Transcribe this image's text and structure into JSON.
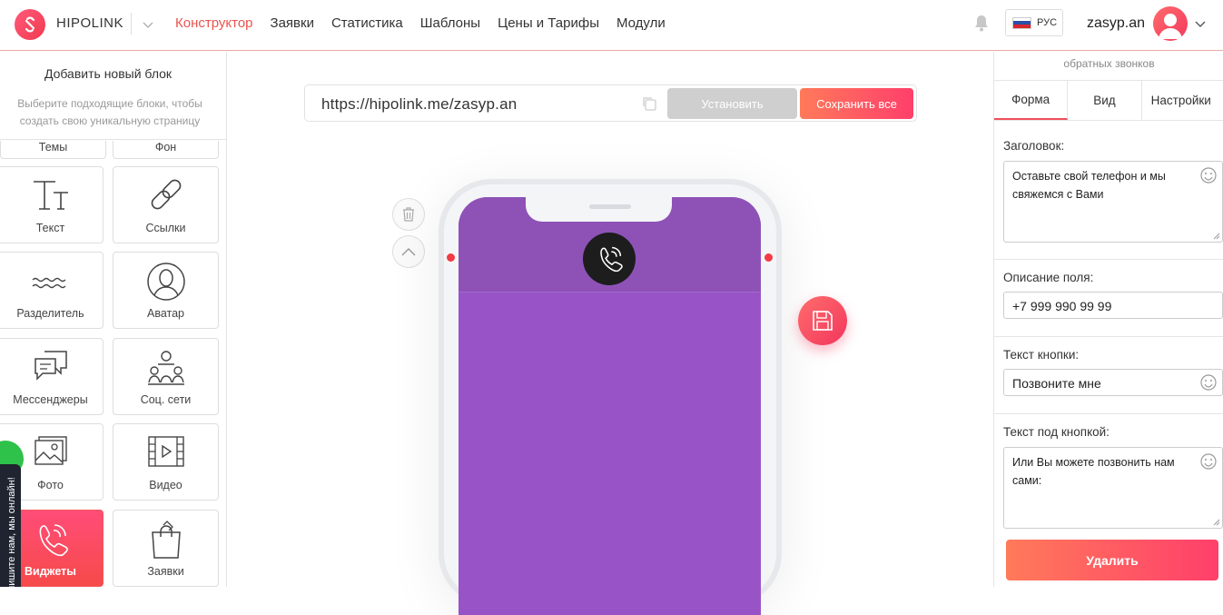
{
  "header": {
    "brand": "HIPOLINK",
    "nav": [
      {
        "label": "Конструктор",
        "active": true
      },
      {
        "label": "Заявки",
        "active": false
      },
      {
        "label": "Статистика",
        "active": false
      },
      {
        "label": "Шаблоны",
        "active": false
      },
      {
        "label": "Цены и Тарифы",
        "active": false
      },
      {
        "label": "Модули",
        "active": false
      }
    ],
    "language": "РУС",
    "username": "zasyp.an"
  },
  "left_panel": {
    "title": "Добавить новый блок",
    "hint": "Выберите подходящие блоки, чтобы создать свою уникальную страницу",
    "cut_tiles": [
      "Темы",
      "Фон"
    ],
    "tiles": [
      {
        "label": "Текст",
        "icon": "text-icon",
        "active": false
      },
      {
        "label": "Ссылки",
        "icon": "link-icon",
        "active": false
      },
      {
        "label": "Разделитель",
        "icon": "divider-icon",
        "active": false
      },
      {
        "label": "Аватар",
        "icon": "avatar-icon",
        "active": false
      },
      {
        "label": "Мессенджеры",
        "icon": "messengers-icon",
        "active": false
      },
      {
        "label": "Соц. сети",
        "icon": "social-icon",
        "active": false
      },
      {
        "label": "Фото",
        "icon": "photo-icon",
        "active": false
      },
      {
        "label": "Видео",
        "icon": "video-icon",
        "active": false
      },
      {
        "label": "Виджеты",
        "icon": "phone-icon",
        "active": true
      },
      {
        "label": "Заявки",
        "icon": "bag-icon",
        "active": false
      }
    ],
    "chat_tab": "Напишите нам, мы онлайн!"
  },
  "center": {
    "url": "https://hipolink.me/zasyp.an",
    "install_label": "Установить",
    "save_all_label": "Сохранить все"
  },
  "right_panel": {
    "caption": "обратных звонков",
    "tabs": [
      {
        "label": "Форма",
        "active": true
      },
      {
        "label": "Вид",
        "active": false
      },
      {
        "label": "Настройки",
        "active": false
      }
    ],
    "fields": {
      "title_label": "Заголовок:",
      "title_value": "Оставьте свой телефон и мы свяжемся с Вами",
      "desc_label": "Описание поля:",
      "desc_value": "+7 999 990 99 99",
      "button_label": "Текст кнопки:",
      "button_value": "Позвоните мне",
      "under_label": "Текст под кнопкой:",
      "under_value": "Или Вы можете позвонить нам сами:"
    },
    "delete_label": "Удалить"
  },
  "colors": {
    "accent": "#e9534f",
    "phone_screen": "#9854c6",
    "save_gradient_start": "#ff7a5a",
    "save_gradient_end": "#ff3f6b"
  }
}
